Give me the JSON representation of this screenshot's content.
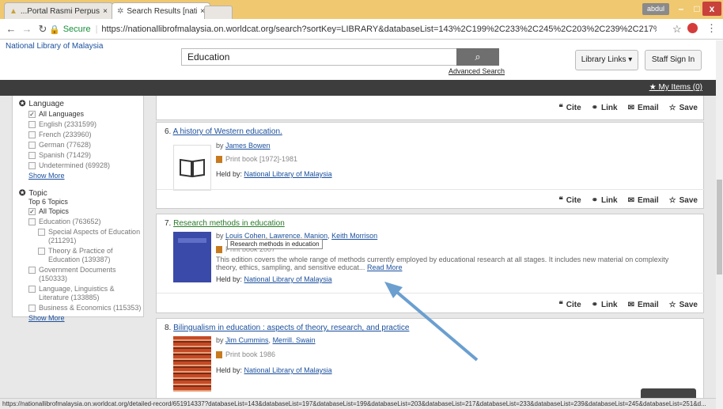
{
  "tabs": [
    {
      "label": "...Portal Rasmi Perpustak",
      "close": "×"
    },
    {
      "label": "Search Results [nationall",
      "close": "×"
    }
  ],
  "window": {
    "profile": "abdul",
    "minimize": "–",
    "maximize": "□",
    "close": "x"
  },
  "address": {
    "secure_label": "Secure",
    "url": "https://nationallibrofmalaysia.on.worldcat.org/search?sortKey=LIBRARY&databaseList=143%2C199%2C233%2C245%2C203%2C239%2C217%2C638%2C283%2C251%2C197%..."
  },
  "site": {
    "library_name": "National Library of Malaysia",
    "search_value": "Education",
    "advanced_search": "Advanced Search",
    "library_links": "Library Links ▾",
    "staff_sign_in": "Staff Sign In",
    "my_items": "My Items (0)"
  },
  "facets": {
    "language_heading": "Language",
    "language_items": [
      {
        "label": "All Languages",
        "checked": true
      },
      {
        "label": "English (2331599)",
        "checked": false
      },
      {
        "label": "French (233960)",
        "checked": false
      },
      {
        "label": "German (77628)",
        "checked": false
      },
      {
        "label": "Spanish (71429)",
        "checked": false
      },
      {
        "label": "Undetermined (69928)",
        "checked": false
      }
    ],
    "show_more": "Show More",
    "topic_heading": "Topic",
    "topic_sub": "Top 6 Topics",
    "topic_items": [
      {
        "label": "All Topics",
        "checked": true,
        "indent": false
      },
      {
        "label": "Education (763652)",
        "checked": false,
        "indent": false
      },
      {
        "label": "Special Aspects of Education (211291)",
        "checked": false,
        "indent": true
      },
      {
        "label": "Theory & Practice of Education (139387)",
        "checked": false,
        "indent": true
      },
      {
        "label": "Government Documents (150333)",
        "checked": false,
        "indent": false
      },
      {
        "label": "Language, Linguistics & Literature (133885)",
        "checked": false,
        "indent": false
      },
      {
        "label": "Business & Economics (115353)",
        "checked": false,
        "indent": false
      }
    ],
    "show_more_2": "Show More"
  },
  "actions": {
    "cite": "Cite",
    "link": "Link",
    "email": "Email",
    "save": "Save"
  },
  "results": [
    {
      "num": "6.",
      "title": "A history of Western education.",
      "by": "by",
      "authors": [
        "James Bowen"
      ],
      "format": "Print book [1972]-1981",
      "held_label": "Held by:",
      "held_by": "National Library of Malaysia"
    },
    {
      "num": "7.",
      "title": "Research methods in education",
      "by": "by",
      "authors": [
        "Louis Cohen",
        "Lawrence. Manion",
        "Keith Morrison"
      ],
      "format": "Print book 2007",
      "description": "This edition covers the whole range of methods currently employed by educational research at all stages. It includes new material on complexity theory, ethics, sampling, and sensitive educat...",
      "read_more": "Read More",
      "held_label": "Held by:",
      "held_by": "National Library of Malaysia"
    },
    {
      "num": "8.",
      "title": "Bilingualism in education : aspects of theory, research, and practice",
      "by": "by",
      "authors": [
        "Jim Cummins",
        "Merrill. Swain"
      ],
      "format": "Print book 1986",
      "held_label": "Held by:",
      "held_by": "National Library of Malaysia"
    }
  ],
  "tooltip": "Research methods in education",
  "status_url": "https://nationallibrofmalaysia.on.worldcat.org/detailed-record/651914337?databaseList=143&databaseList=197&databaseList=199&databaseList=203&databaseList=217&databaseList=233&databaseList=239&databaseList=245&databaseList=251&d...",
  "colors": {
    "link": "#1a4f9c",
    "secure": "#1a8f3c",
    "arrow": "#6a9fd0",
    "bar": "#3d3d3d"
  },
  "icons": [
    "back-arrow-icon",
    "forward-arrow-icon",
    "reload-icon",
    "lock-icon",
    "star-icon",
    "search-icon",
    "quote-icon",
    "link-icon",
    "envelope-icon",
    "star-outline-icon",
    "book-icon"
  ]
}
